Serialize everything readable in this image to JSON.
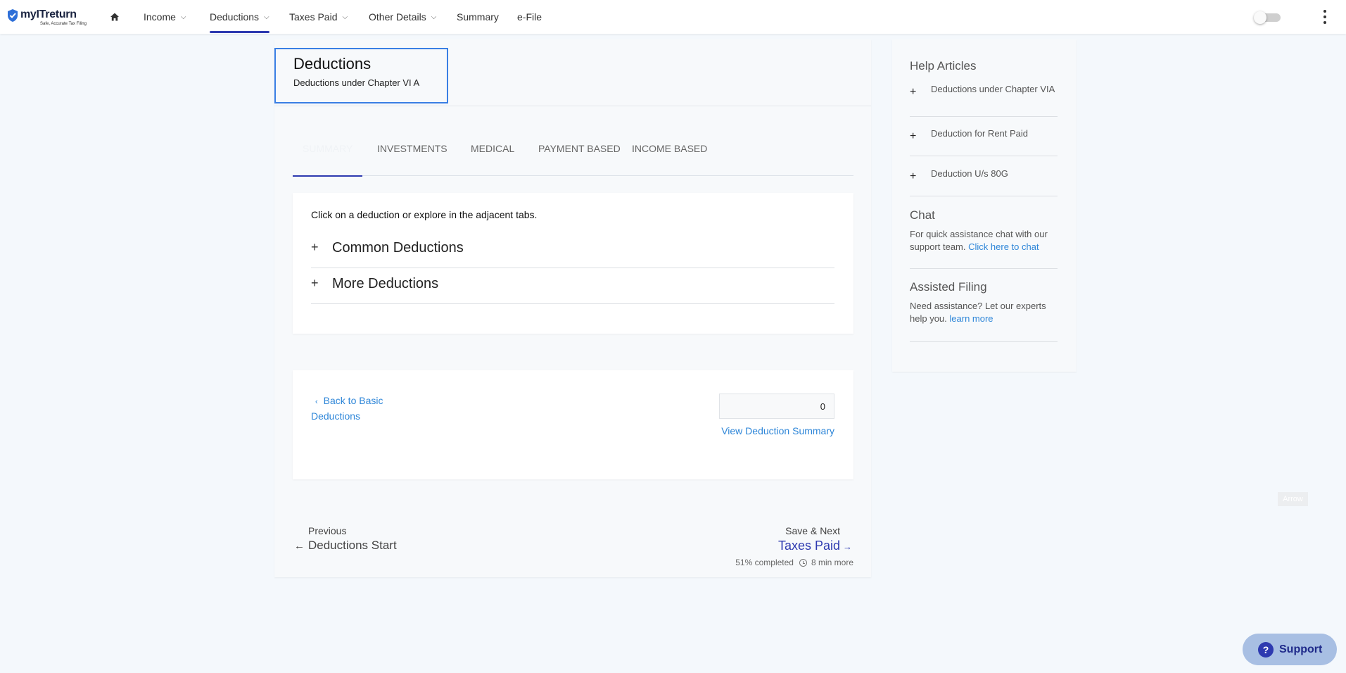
{
  "brand": {
    "name": "myITreturn",
    "tagline": "Safe, Accurate Tax Filing"
  },
  "nav": {
    "items": [
      {
        "label": "Income",
        "has_menu": true
      },
      {
        "label": "Deductions",
        "has_menu": true,
        "active": true
      },
      {
        "label": "Taxes Paid",
        "has_menu": true
      },
      {
        "label": "Other Details",
        "has_menu": true
      },
      {
        "label": "Summary",
        "has_menu": false
      },
      {
        "label": "e-File",
        "has_menu": false
      }
    ]
  },
  "header": {
    "title": "Deductions",
    "subtitle": "Deductions under Chapter VI A"
  },
  "tabs": [
    {
      "label": "SUMMARY",
      "active": true
    },
    {
      "label": "INVESTMENTS"
    },
    {
      "label": "MEDICAL"
    },
    {
      "label": "PAYMENT BASED"
    },
    {
      "label": "INCOME BASED"
    }
  ],
  "summary_card": {
    "hint": "Click on a deduction or explore in the adjacent tabs.",
    "sections": [
      {
        "label": "Common Deductions"
      },
      {
        "label": "More Deductions"
      }
    ]
  },
  "action_card": {
    "back_label": "Back to Basic Deductions",
    "count_value": "0",
    "view_summary_label": "View Deduction Summary"
  },
  "footer_nav": {
    "prev_small": "Previous",
    "prev_label": "Deductions Start",
    "next_small": "Save & Next",
    "next_label": "Taxes Paid",
    "progress_text": "51% completed",
    "time_text": "8 min more"
  },
  "sidebar": {
    "help_title": "Help Articles",
    "help_items": [
      {
        "label": "Deductions under Chapter VIA"
      },
      {
        "label": "Deduction for Rent Paid"
      },
      {
        "label": "Deduction U/s 80G"
      }
    ],
    "chat_title": "Chat",
    "chat_text": "For quick assistance chat with our support team.",
    "chat_link": "Click here to chat",
    "assisted_title": "Assisted Filing",
    "assisted_text": "Need assistance? Let our experts help you.",
    "assisted_link": "learn more"
  },
  "arrow_tag": "Arrow",
  "support_button": {
    "label": "Support"
  },
  "colors": {
    "accent": "#2e3ab0",
    "link": "#2e86d8",
    "highlight_border": "#3a7fe4"
  }
}
